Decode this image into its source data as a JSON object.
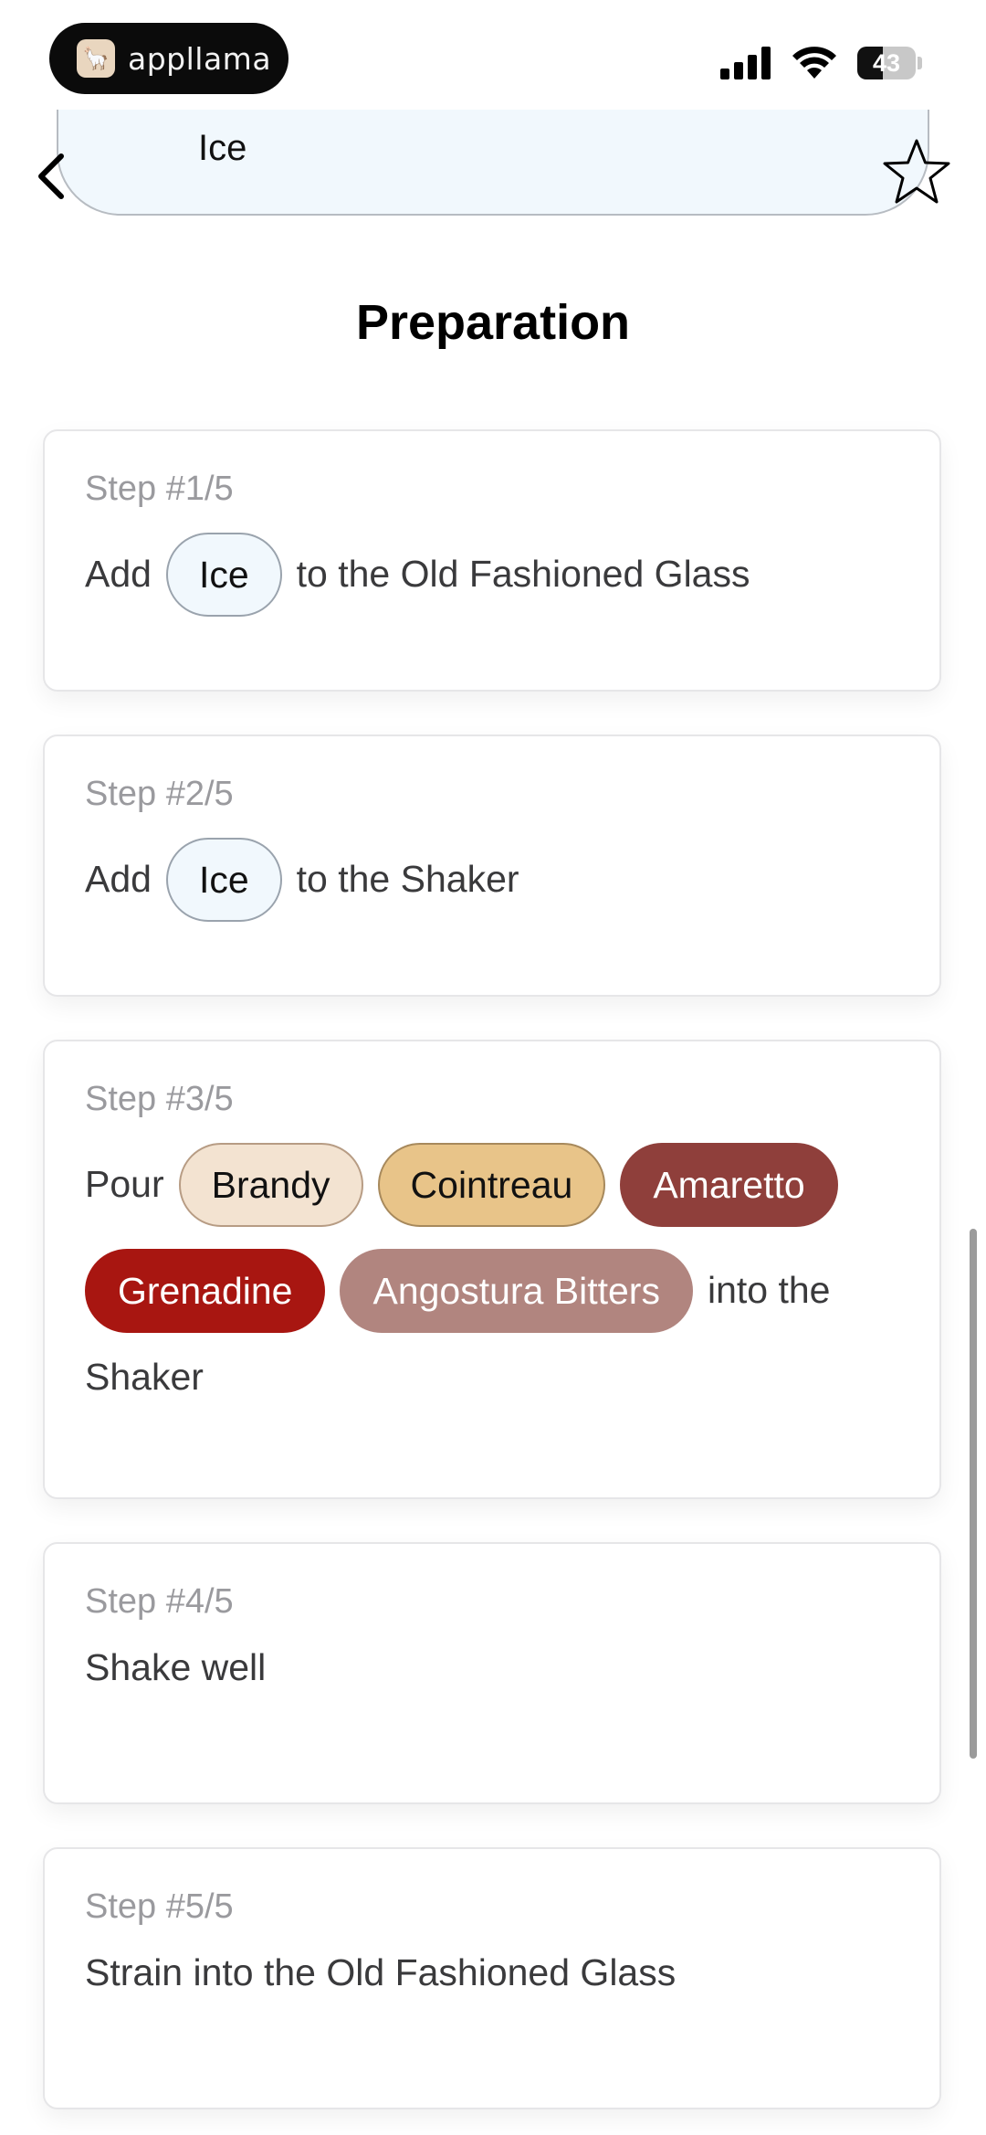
{
  "status_bar": {
    "app_name": "appllama",
    "app_logo_icon": "llama-icon",
    "battery_level": 43,
    "battery_text": "43"
  },
  "header": {
    "ingredient_label": "Ice",
    "back_icon": "chevron-left-icon",
    "favorite_icon": "star-outline-icon"
  },
  "section": {
    "title": "Preparation"
  },
  "steps": [
    {
      "label": "Step #1/5",
      "parts": [
        "Add",
        "Ice",
        "to the Old Fashioned Glass"
      ]
    },
    {
      "label": "Step #2/5",
      "parts": [
        "Add",
        "Ice",
        "to the Shaker"
      ]
    },
    {
      "label": "Step #3/5",
      "parts": [
        "Pour",
        "Brandy",
        "Cointreau",
        "Amaretto",
        "Grenadine",
        "Angostura Bitters",
        "into the",
        "Shaker"
      ]
    },
    {
      "label": "Step #4/5",
      "parts": [
        "Shake well"
      ]
    },
    {
      "label": "Step #5/5",
      "parts": [
        "Strain into the Old Fashioned Glass"
      ]
    }
  ],
  "colors": {
    "ice": "#f1f8fd",
    "brandy": "#f3e3d1",
    "cointreau": "#e8c489",
    "amaretto": "#8f3f3b",
    "grenadine": "#a81611",
    "angostura": "#b1857f"
  }
}
